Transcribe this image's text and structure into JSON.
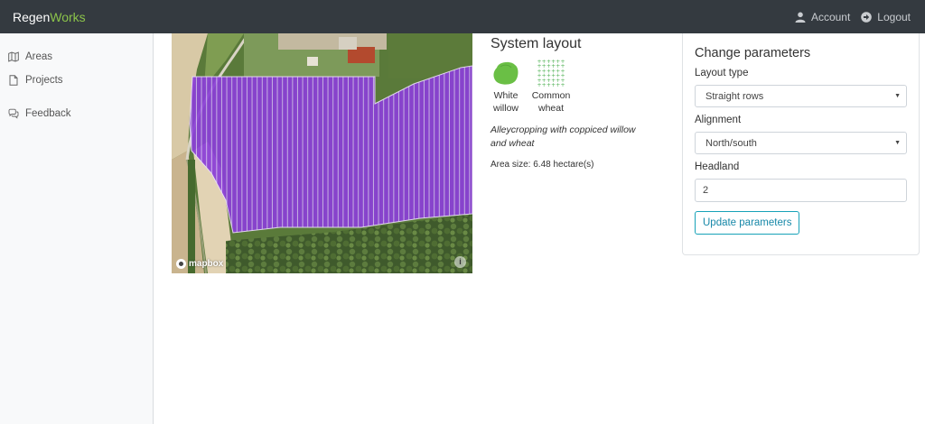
{
  "app": {
    "brand_prefix": "Regen",
    "brand_suffix": "Works",
    "brand_accent_color": "#8bc34a",
    "navbar_color": "#343a40"
  },
  "nav": {
    "account_label": "Account",
    "account_icon": "user-icon",
    "logout_label": "Logout",
    "logout_icon": "logout-arrow-icon"
  },
  "sidebar": {
    "items": [
      {
        "label": "Areas",
        "icon": "map-icon"
      },
      {
        "label": "Projects",
        "icon": "document-icon"
      },
      {
        "label": "Feedback",
        "icon": "chat-icon"
      }
    ]
  },
  "map": {
    "attribution_logo": "mapbox",
    "info_icon": "info-icon",
    "overlay_color": "#8a3fd6"
  },
  "system_layout": {
    "title": "System layout",
    "crops": [
      {
        "name_line1": "White",
        "name_line2": "willow",
        "icon": "willow-tree-icon",
        "color": "#6abf45"
      },
      {
        "name_line1": "Common",
        "name_line2": "wheat",
        "icon": "wheat-grid-icon",
        "color": "#4caf50"
      }
    ],
    "description": "Alleycropping with coppiced willow and wheat",
    "area_size": "Area size: 6.48 hectare(s)"
  },
  "parameters": {
    "title": "Change parameters",
    "layout_type_label": "Layout type",
    "layout_type_value": "Straight rows",
    "alignment_label": "Alignment",
    "alignment_value": "North/south",
    "headland_label": "Headland",
    "headland_value": "2",
    "update_button": "Update parameters",
    "button_color": "#17a2b8"
  }
}
